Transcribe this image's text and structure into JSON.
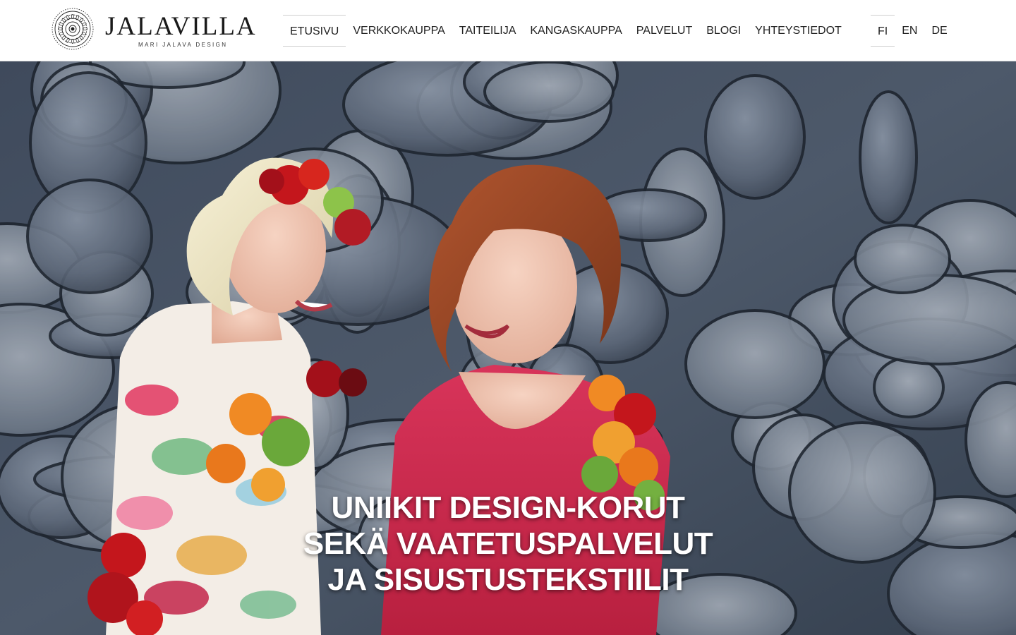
{
  "brand": {
    "name": "JALAVILLA",
    "tagline": "MARI JALAVA DESIGN"
  },
  "nav": {
    "items": [
      {
        "label": "ETUSIVU",
        "active": true
      },
      {
        "label": "VERKKOKAUPPA",
        "active": false
      },
      {
        "label": "TAITEILIJA",
        "active": false
      },
      {
        "label": "KANGASKAUPPA",
        "active": false
      },
      {
        "label": "PALVELUT",
        "active": false
      },
      {
        "label": "BLOGI",
        "active": false
      },
      {
        "label": "YHTEYSTIEDOT",
        "active": false
      }
    ]
  },
  "languages": {
    "items": [
      {
        "label": "FI",
        "active": true
      },
      {
        "label": "EN",
        "active": false
      },
      {
        "label": "DE",
        "active": false
      }
    ]
  },
  "hero": {
    "lines": [
      "UNIIKIT DESIGN-KORUT",
      "SEKÄ VAATETUSPALVELUT",
      "JA SISUSTUSTEKSTIILIT"
    ]
  },
  "colors": {
    "header_bg": "#ffffff",
    "text": "#222222",
    "active_border": "#cfcfcf",
    "hero_text": "#ffffff"
  }
}
